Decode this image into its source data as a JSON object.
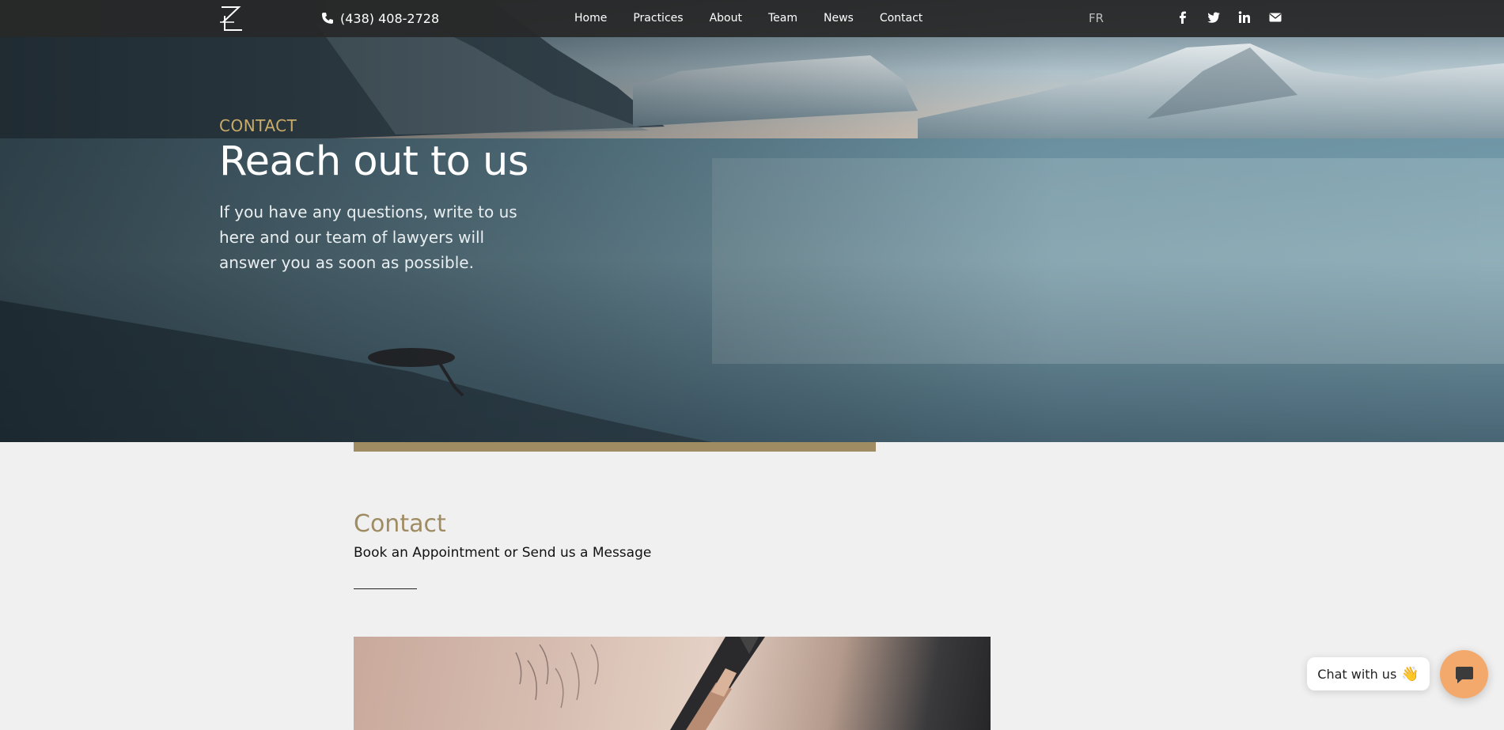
{
  "nav": {
    "phone": "(438) 408-2728",
    "links": [
      "Home",
      "Practices",
      "About",
      "Team",
      "News",
      "Contact"
    ],
    "language": "FR",
    "social_icons": [
      "facebook-icon",
      "twitter-icon",
      "linkedin-icon",
      "envelope-icon"
    ]
  },
  "hero": {
    "eyebrow": "CONTACT",
    "title": "Reach out to us",
    "description": "If you have any questions, write to us here and our team of lawyers will answer you as soon as possible."
  },
  "contact": {
    "heading": "Contact",
    "subheading": "Book an Appointment or Send us a Message"
  },
  "chat": {
    "label": "Chat with us",
    "emoji": "👋"
  },
  "colors": {
    "accent_gold": "#a08c62",
    "eyebrow_gold": "#c9ab6a",
    "nav_bg": "#282828",
    "page_bg": "#f0f0f0",
    "chat_button": "#f3a96b"
  }
}
